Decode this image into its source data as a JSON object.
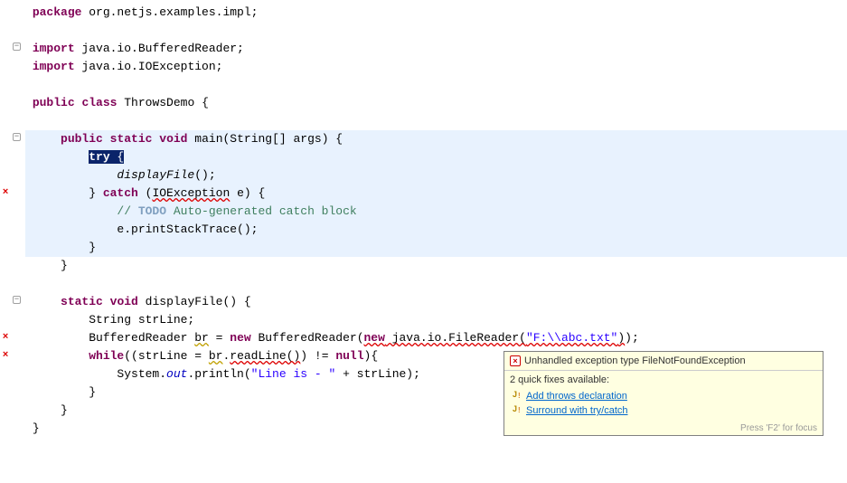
{
  "code": {
    "l1": "package",
    "l1b": " org.netjs.examples.impl;",
    "l3a": "import",
    "l3b": " java.io.BufferedReader;",
    "l4a": "import",
    "l4b": " java.io.IOException;",
    "l6a": "public",
    "l6b": "class",
    "l6c": " ThrowsDemo {",
    "l8a": "public",
    "l8b": "static",
    "l8c": "void",
    "l8d": " main(String[] args) {",
    "l9a": "try",
    "l9b": " {",
    "l10": "displayFile",
    "l10b": "();",
    "l11a": "} ",
    "l11b": "catch",
    "l11c": " (",
    "l11d": "IOException",
    "l11e": " e) {",
    "l12a": "// ",
    "l12b": "TODO",
    "l12c": " Auto-generated catch block",
    "l13": "e.printStackTrace();",
    "l14": "}",
    "l15": "}",
    "l17a": "static",
    "l17b": "void",
    "l17c": " displayFile() {",
    "l18": "String strLine;",
    "l19a": "BufferedReader ",
    "l19b": "br",
    "l19c": " = ",
    "l19d": "new",
    "l19e": " BufferedReader(",
    "l19f": "new",
    "l19g": " java.io.FileReader(",
    "l19h": "\"F:\\\\abc.txt\"",
    "l19i": "));",
    "l20a": "while",
    "l20b": "((strLine = ",
    "l20c": "br",
    "l20d": ".",
    "l20e": "readLine()",
    "l20f": ") != ",
    "l20g": "null",
    "l20h": "){",
    "l21a": "System.",
    "l21b": "out",
    "l21c": ".println(",
    "l21d": "\"Line is - \"",
    "l21e": " + strLine);",
    "l22": "}",
    "l23": "}",
    "l24": "}"
  },
  "tooltip": {
    "header": "Unhandled exception type FileNotFoundException",
    "body": "2 quick fixes available:",
    "fix1": "Add throws declaration",
    "fix2": "Surround with try/catch",
    "footer": "Press 'F2' for focus"
  }
}
